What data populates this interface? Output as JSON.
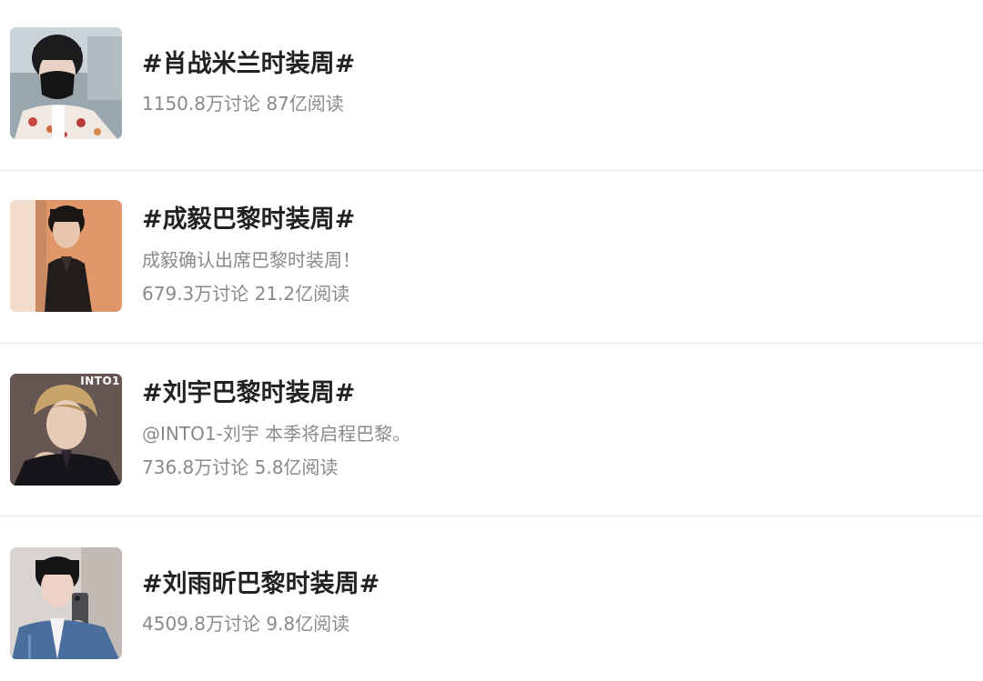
{
  "topics": [
    {
      "title": "#肖战米兰时装周#",
      "stats": "1150.8万讨论 87亿阅读",
      "thumb_icon": "person-with-mask-photo"
    },
    {
      "title": "#成毅巴黎时装周#",
      "description": "成毅确认出席巴黎时装周！",
      "stats": "679.3万讨论 21.2亿阅读",
      "thumb_icon": "person-portrait-photo"
    },
    {
      "title": "#刘宇巴黎时装周#",
      "description": "@INTO1-刘宇 本季将启程巴黎。",
      "stats": "736.8万讨论 5.8亿阅读",
      "thumb_icon": "person-portrait-photo",
      "thumb_watermark": "INTO1"
    },
    {
      "title": "#刘雨昕巴黎时装周#",
      "stats": "4509.8万讨论 9.8亿阅读",
      "thumb_icon": "person-selfie-photo"
    }
  ],
  "colors": {
    "title": "#222222",
    "meta": "#8a8a8a",
    "divider": "#f3f3f3"
  }
}
